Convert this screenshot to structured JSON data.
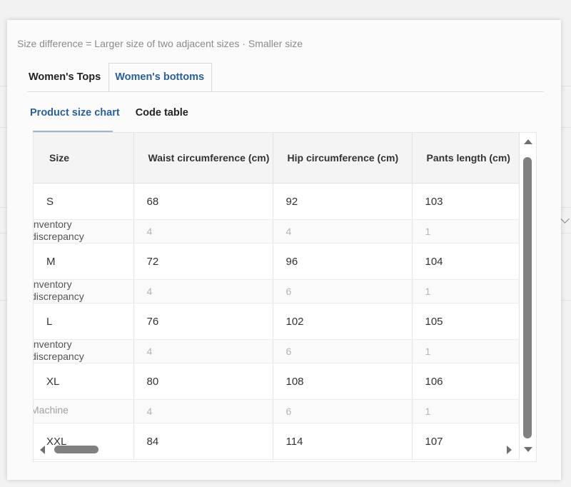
{
  "hint": "Size difference = Larger size of two adjacent sizes · Smaller size",
  "tabs": [
    "Women's Tops",
    "Women's bottoms"
  ],
  "subtabs": [
    "Product size chart",
    "Code table"
  ],
  "table": {
    "headers": [
      "Size",
      "Waist circumference (cm)",
      "Hip circumference (cm)",
      "Pants length (cm)"
    ],
    "rows": [
      {
        "size": "S",
        "waist": "68",
        "hip": "92",
        "length": "103"
      },
      {
        "label": "Inventory\ndiscrepancy",
        "waist": "4",
        "hip": "4",
        "length": "1"
      },
      {
        "size": "M",
        "waist": "72",
        "hip": "96",
        "length": "104"
      },
      {
        "label": "Inventory\ndiscrepancy",
        "waist": "4",
        "hip": "6",
        "length": "1"
      },
      {
        "size": "L",
        "waist": "76",
        "hip": "102",
        "length": "105"
      },
      {
        "label": "Inventory\ndiscrepancy",
        "waist": "4",
        "hip": "6",
        "length": "1"
      },
      {
        "size": "XL",
        "waist": "80",
        "hip": "108",
        "length": "106"
      },
      {
        "label": "Machine",
        "waist": "4",
        "hip": "6",
        "length": "1"
      },
      {
        "size": "XXL",
        "waist": "84",
        "hip": "114",
        "length": "107"
      }
    ]
  },
  "colors": {
    "accent": "#2c6098",
    "scrollbar": "#808080"
  },
  "icons": [
    "scroll-up-arrow-icon",
    "scroll-down-arrow-icon",
    "scroll-left-arrow-icon",
    "scroll-right-arrow-icon"
  ]
}
